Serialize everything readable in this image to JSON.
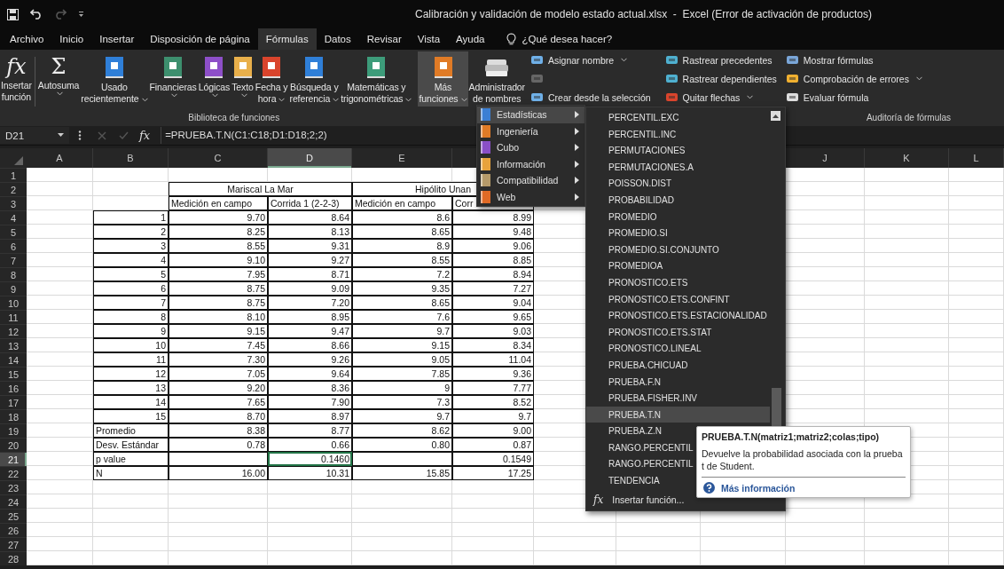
{
  "window": {
    "title": "Calibración y validación de modelo estado actual.xlsx  -  Excel (Error de activación de productos)"
  },
  "tabs": [
    {
      "label": "Archivo",
      "selected": false
    },
    {
      "label": "Inicio",
      "selected": false
    },
    {
      "label": "Insertar",
      "selected": false
    },
    {
      "label": "Disposición de página",
      "selected": false
    },
    {
      "label": "Fórmulas",
      "selected": true
    },
    {
      "label": "Datos",
      "selected": false
    },
    {
      "label": "Revisar",
      "selected": false
    },
    {
      "label": "Vista",
      "selected": false
    },
    {
      "label": "Ayuda",
      "selected": false
    }
  ],
  "tell_me": {
    "placeholder": "¿Qué desea hacer?"
  },
  "ribbon": {
    "library": {
      "label": "Biblioteca de funciones",
      "buttons": [
        {
          "kind": "glyph",
          "glyph": "fx",
          "label": "Insertar\nfunción",
          "dropdown": false,
          "selected": false
        },
        {
          "kind": "glyph",
          "glyph": "Σ",
          "label": "Autosuma",
          "dropdown": true,
          "selected": false
        },
        {
          "kind": "book",
          "color": "#2f7fd8",
          "label": "Usado\nrecientemente",
          "dropdown": true,
          "selected": false
        },
        {
          "kind": "book",
          "color": "#3d8f6e",
          "label": "Financieras",
          "dropdown": true,
          "selected": false
        },
        {
          "kind": "book",
          "color": "#8d4fc8",
          "label": "Lógicas",
          "dropdown": true,
          "selected": false
        },
        {
          "kind": "book",
          "color": "#e9b04b",
          "label": "Texto",
          "dropdown": true,
          "selected": false
        },
        {
          "kind": "book",
          "color": "#d9442c",
          "label": "Fecha y\nhora",
          "dropdown": true,
          "selected": false
        },
        {
          "kind": "book",
          "color": "#2f7fd8",
          "label": "Búsqueda y\nreferencia",
          "dropdown": true,
          "selected": false
        },
        {
          "kind": "book",
          "color": "#3d9c7a",
          "label": "Matemáticas y\ntrigonométricas",
          "dropdown": true,
          "selected": false
        },
        {
          "kind": "book",
          "color": "#e07b26",
          "label": "Más\nfunciones",
          "dropdown": true,
          "selected": true
        }
      ]
    },
    "names": {
      "manager": {
        "label": "Administrador\nde nombres"
      },
      "items": [
        {
          "label": "Asignar nombre",
          "dropdown": true,
          "disabled": false
        },
        {
          "disabled": true
        },
        {
          "label": "Crear desde la selección",
          "dropdown": false,
          "disabled": false
        }
      ]
    },
    "auditing": {
      "label": "Auditoría de fórmulas",
      "items": [
        {
          "label": "Rastrear precedentes",
          "dropdown": false
        },
        {
          "label": "Rastrear dependientes",
          "dropdown": false
        },
        {
          "label": "Quitar flechas",
          "dropdown": true
        },
        {
          "label": "Mostrar fórmulas",
          "dropdown": false
        },
        {
          "label": "Comprobación de errores",
          "dropdown": true
        },
        {
          "label": "Evaluar fórmula",
          "dropdown": false
        }
      ]
    }
  },
  "formula_bar": {
    "name_box": "D21",
    "fx": "fx",
    "formula": "=PRUEBA.T.N(C1:C18;D1:D18;2;2)"
  },
  "sheet": {
    "columns": [
      {
        "label": "A",
        "selected": false
      },
      {
        "label": "B",
        "selected": false
      },
      {
        "label": "C",
        "selected": false
      },
      {
        "label": "D",
        "selected": true
      },
      {
        "label": "E",
        "selected": false
      },
      {
        "label": "J",
        "selected": false
      },
      {
        "label": "K",
        "selected": false
      },
      {
        "label": "L",
        "selected": false
      }
    ],
    "rows": [
      {
        "label": "1",
        "selected": false
      },
      {
        "label": "2",
        "selected": false
      },
      {
        "label": "3",
        "selected": false
      },
      {
        "label": "4",
        "selected": false
      },
      {
        "label": "5",
        "selected": false
      },
      {
        "label": "6",
        "selected": false
      },
      {
        "label": "7",
        "selected": false
      },
      {
        "label": "8",
        "selected": false
      },
      {
        "label": "9",
        "selected": false
      },
      {
        "label": "10",
        "selected": false
      },
      {
        "label": "11",
        "selected": false
      },
      {
        "label": "12",
        "selected": false
      },
      {
        "label": "13",
        "selected": false
      },
      {
        "label": "14",
        "selected": false
      },
      {
        "label": "15",
        "selected": false
      },
      {
        "label": "16",
        "selected": false
      },
      {
        "label": "17",
        "selected": false
      },
      {
        "label": "18",
        "selected": false
      },
      {
        "label": "19",
        "selected": false
      },
      {
        "label": "20",
        "selected": false
      },
      {
        "label": "21",
        "selected": true
      },
      {
        "label": "22",
        "selected": false
      },
      {
        "label": "23",
        "selected": false
      },
      {
        "label": "24",
        "selected": false
      },
      {
        "label": "25",
        "selected": false
      },
      {
        "label": "26",
        "selected": false
      },
      {
        "label": "27",
        "selected": false
      },
      {
        "label": "28",
        "selected": false
      }
    ],
    "table": {
      "groups": [
        {
          "title": "Mariscal La Mar"
        },
        {
          "title": "Hipólito Unan"
        }
      ],
      "headers": [
        "Medición en campo",
        "Corrida 1 (2-2-3)",
        "Medición en campo",
        "Corr"
      ],
      "rows": [
        {
          "kind": "index",
          "label": "1",
          "mariscal_campo": "9.70",
          "mariscal_corrida": "8.64",
          "hipolito_campo": "8.6",
          "hipolito_corr": "8.99"
        },
        {
          "kind": "index",
          "label": "2",
          "mariscal_campo": "8.25",
          "mariscal_corrida": "8.13",
          "hipolito_campo": "8.65",
          "hipolito_corr": "9.48"
        },
        {
          "kind": "index",
          "label": "3",
          "mariscal_campo": "8.55",
          "mariscal_corrida": "9.31",
          "hipolito_campo": "8.9",
          "hipolito_corr": "9.06"
        },
        {
          "kind": "index",
          "label": "4",
          "mariscal_campo": "9.10",
          "mariscal_corrida": "9.27",
          "hipolito_campo": "8.55",
          "hipolito_corr": "8.85"
        },
        {
          "kind": "index",
          "label": "5",
          "mariscal_campo": "7.95",
          "mariscal_corrida": "8.71",
          "hipolito_campo": "7.2",
          "hipolito_corr": "8.94"
        },
        {
          "kind": "index",
          "label": "6",
          "mariscal_campo": "8.75",
          "mariscal_corrida": "9.09",
          "hipolito_campo": "9.35",
          "hipolito_corr": "7.27"
        },
        {
          "kind": "index",
          "label": "7",
          "mariscal_campo": "8.75",
          "mariscal_corrida": "7.20",
          "hipolito_campo": "8.65",
          "hipolito_corr": "9.04"
        },
        {
          "kind": "index",
          "label": "8",
          "mariscal_campo": "8.10",
          "mariscal_corrida": "8.95",
          "hipolito_campo": "7.6",
          "hipolito_corr": "9.65"
        },
        {
          "kind": "index",
          "label": "9",
          "mariscal_campo": "9.15",
          "mariscal_corrida": "9.47",
          "hipolito_campo": "9.7",
          "hipolito_corr": "9.03"
        },
        {
          "kind": "index",
          "label": "10",
          "mariscal_campo": "7.45",
          "mariscal_corrida": "8.66",
          "hipolito_campo": "9.15",
          "hipolito_corr": "8.34"
        },
        {
          "kind": "index",
          "label": "11",
          "mariscal_campo": "7.30",
          "mariscal_corrida": "9.26",
          "hipolito_campo": "9.05",
          "hipolito_corr": "11.04"
        },
        {
          "kind": "index",
          "label": "12",
          "mariscal_campo": "7.05",
          "mariscal_corrida": "9.64",
          "hipolito_campo": "7.85",
          "hipolito_corr": "9.36"
        },
        {
          "kind": "index",
          "label": "13",
          "mariscal_campo": "9.20",
          "mariscal_corrida": "8.36",
          "hipolito_campo": "9",
          "hipolito_corr": "7.77"
        },
        {
          "kind": "index",
          "label": "14",
          "mariscal_campo": "7.65",
          "mariscal_corrida": "7.90",
          "hipolito_campo": "7.3",
          "hipolito_corr": "8.52"
        },
        {
          "kind": "index",
          "label": "15",
          "mariscal_campo": "8.70",
          "mariscal_corrida": "8.97",
          "hipolito_campo": "9.7",
          "hipolito_corr": "9.7"
        },
        {
          "kind": "stat",
          "label": "Promedio",
          "mariscal_campo": "8.38",
          "mariscal_corrida": "8.77",
          "hipolito_campo": "8.62",
          "hipolito_corr": "9.00"
        },
        {
          "kind": "stat",
          "label": "Desv. Estándar",
          "mariscal_campo": "0.78",
          "mariscal_corrida": "0.66",
          "hipolito_campo": "0.80",
          "hipolito_corr": "0.87"
        },
        {
          "kind": "stat",
          "label": "p value",
          "mariscal_corrida": {
            "text": "0.1460",
            "selected": true
          },
          "hipolito_corr": "0.1549"
        },
        {
          "kind": "stat",
          "label": "N",
          "mariscal_campo": "16.00",
          "mariscal_corrida": "10.31",
          "hipolito_campo": "15.85",
          "hipolito_corr": "17.25"
        }
      ]
    }
  },
  "category_menu": {
    "items": [
      {
        "label": "Estadísticas",
        "color": "#3b7fd4",
        "selected": true
      },
      {
        "label": "Ingeniería",
        "color": "#e07b26",
        "selected": false
      },
      {
        "label": "Cubo",
        "color": "#8a4fc7",
        "selected": false
      },
      {
        "label": "Información",
        "color": "#e8a33c",
        "selected": false
      },
      {
        "label": "Compatibilidad",
        "color": "#b59a6a",
        "selected": false
      },
      {
        "label": "Web",
        "color": "#e06a26",
        "selected": false
      }
    ]
  },
  "function_menu": {
    "items": [
      {
        "label": "PERCENTIL.EXC",
        "selected": false
      },
      {
        "label": "PERCENTIL.INC",
        "selected": false
      },
      {
        "label": "PERMUTACIONES",
        "selected": false
      },
      {
        "label": "PERMUTACIONES.A",
        "selected": false
      },
      {
        "label": "POISSON.DIST",
        "selected": false
      },
      {
        "label": "PROBABILIDAD",
        "selected": false
      },
      {
        "label": "PROMEDIO",
        "selected": false
      },
      {
        "label": "PROMEDIO.SI",
        "selected": false
      },
      {
        "label": "PROMEDIO.SI.CONJUNTO",
        "selected": false
      },
      {
        "label": "PROMEDIOA",
        "selected": false
      },
      {
        "label": "PRONOSTICO.ETS",
        "selected": false
      },
      {
        "label": "PRONOSTICO.ETS.CONFINT",
        "selected": false
      },
      {
        "label": "PRONOSTICO.ETS.ESTACIONALIDAD",
        "selected": false
      },
      {
        "label": "PRONOSTICO.ETS.STAT",
        "selected": false
      },
      {
        "label": "PRONOSTICO.LINEAL",
        "selected": false
      },
      {
        "label": "PRUEBA.CHICUAD",
        "selected": false
      },
      {
        "label": "PRUEBA.F.N",
        "selected": false
      },
      {
        "label": "PRUEBA.FISHER.INV",
        "selected": false
      },
      {
        "label": "PRUEBA.T.N",
        "selected": true
      },
      {
        "label": "PRUEBA.Z.N",
        "selected": false
      },
      {
        "label": "RANGO.PERCENTIL",
        "selected": false
      },
      {
        "label": "RANGO.PERCENTIL",
        "selected": false
      },
      {
        "label": "TENDENCIA",
        "selected": false
      }
    ],
    "insert": {
      "glyph": "fx",
      "label": "Insertar función..."
    }
  },
  "tooltip": {
    "title": "PRUEBA.T.N(matriz1;matriz2;colas;tipo)",
    "description": "Devuelve la probabilidad asociada con la prueba t de Student.",
    "link": "Más información"
  }
}
